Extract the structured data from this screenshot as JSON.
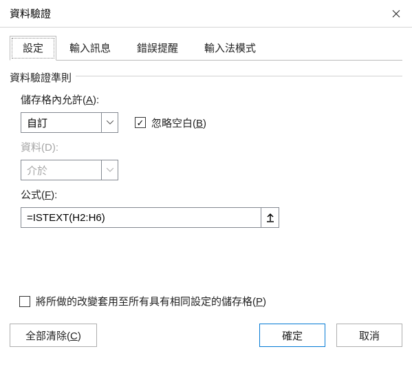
{
  "title": "資料驗證",
  "tabs": [
    {
      "label": "設定"
    },
    {
      "label": "輸入訊息"
    },
    {
      "label": "錯誤提醒"
    },
    {
      "label": "輸入法模式"
    }
  ],
  "fieldset_legend": "資料驗證準則",
  "allow": {
    "label_pre": "儲存格內允許(",
    "label_u": "A",
    "label_post": "):",
    "value": "自訂"
  },
  "ignore_blank": {
    "checked": "✓",
    "label_pre": "忽略空白(",
    "label_u": "B",
    "label_post": ")"
  },
  "data": {
    "label_pre": "資料(",
    "label_u": "D",
    "label_post": "):",
    "value": "介於"
  },
  "formula": {
    "label_pre": "公式(",
    "label_u": "F",
    "label_post": "):",
    "value": "=ISTEXT(H2:H6)"
  },
  "apply_all": {
    "checked": "",
    "label_pre": "將所做的改變套用至所有具有相同設定的儲存格(",
    "label_u": "P",
    "label_post": ")"
  },
  "buttons": {
    "clear_all_pre": "全部清除(",
    "clear_all_u": "C",
    "clear_all_post": ")",
    "ok": "確定",
    "cancel": "取消"
  }
}
